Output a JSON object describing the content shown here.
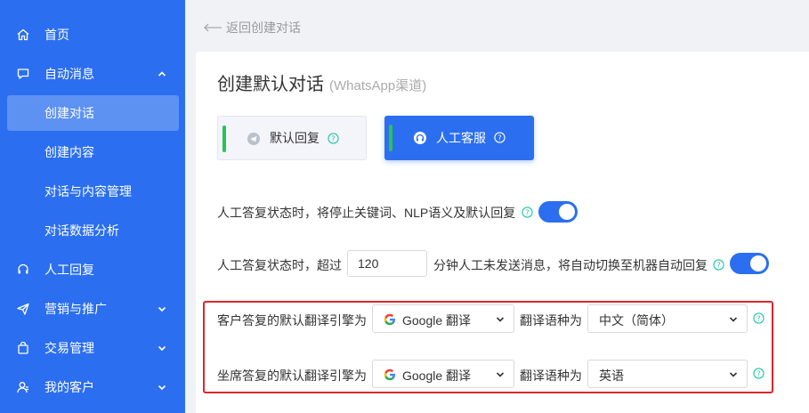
{
  "sidebar": {
    "items": [
      {
        "label": "首页",
        "icon": "home-icon"
      },
      {
        "label": "自动消息",
        "icon": "chat-icon"
      },
      {
        "label": "人工回复",
        "icon": "headset-icon"
      },
      {
        "label": "营销与推广",
        "icon": "send-icon"
      },
      {
        "label": "交易管理",
        "icon": "bag-icon"
      },
      {
        "label": "我的客户",
        "icon": "user-icon"
      }
    ],
    "sub_items": [
      {
        "label": "创建对话",
        "active": true
      },
      {
        "label": "创建内容"
      },
      {
        "label": "对话与内容管理"
      },
      {
        "label": "对话数据分析"
      }
    ]
  },
  "header": {
    "back_label": "返回创建对话"
  },
  "main": {
    "title": "创建默认对话",
    "subtitle": "(WhatsApp渠道)",
    "modes": {
      "default_label": "默认回复",
      "human_label": "人工客服"
    },
    "row1_text": "人工答复状态时，将停止关键词、NLP语义及默认回复",
    "row2_prefix": "人工答复状态时，超过",
    "row2_value": "120",
    "row2_suffix": "分钟人工未发送消息，将自动切换至机器自动回复",
    "translate": {
      "customer_label": "客户答复的默认翻译引擎为",
      "agent_label": "坐席答复的默认翻译引擎为",
      "lang_label": "翻译语种为",
      "engine_value": "Google 翻译",
      "customer_lang": "中文（简体）",
      "agent_lang": "英语"
    }
  },
  "colors": {
    "accent": "#2b6ff0",
    "active_bar": "#2ac255",
    "highlight": "#e0262c",
    "help": "#1ec8a5"
  }
}
